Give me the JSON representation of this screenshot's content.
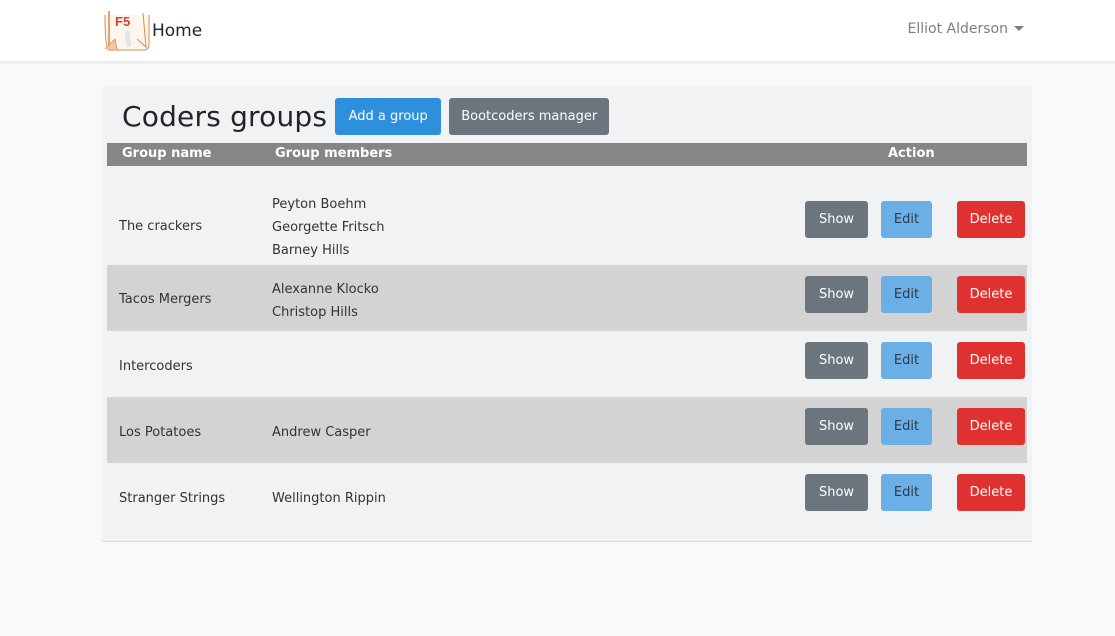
{
  "navbar": {
    "logo_text": "F5",
    "home_label": "Home",
    "user_name": "Elliot Alderson"
  },
  "header": {
    "title": "Coders groups",
    "add_group_label": "Add a group",
    "bootcoders_manager_label": "Bootcoders manager"
  },
  "table": {
    "columns": {
      "group_name": "Group name",
      "group_members": "Group members",
      "action": "Action"
    },
    "actions": {
      "show": "Show",
      "edit": "Edit",
      "delete": "Delete"
    },
    "rows": [
      {
        "name": "The crackers",
        "members": [
          "Peyton Boehm",
          "Georgette Fritsch",
          "Barney Hills"
        ]
      },
      {
        "name": "Tacos Mergers",
        "members": [
          "Alexanne Klocko",
          "Christop Hills"
        ]
      },
      {
        "name": "Intercoders",
        "members": []
      },
      {
        "name": "Los Potatoes",
        "members": [
          "Andrew Casper"
        ]
      },
      {
        "name": "Stranger Strings",
        "members": [
          "Wellington Rippin"
        ]
      }
    ]
  },
  "colors": {
    "primary": "#2e8fdc",
    "secondary": "#6c757d",
    "info": "#6aafe6",
    "danger": "#e03131",
    "table_header": "#868686",
    "row_alt": "#d3d3d3"
  }
}
